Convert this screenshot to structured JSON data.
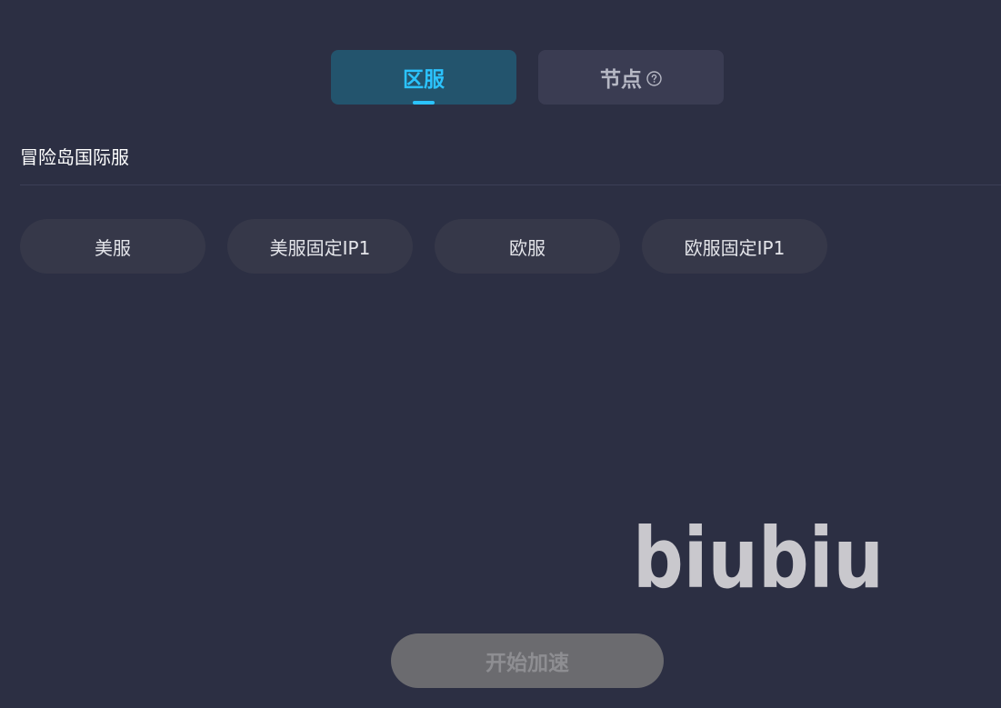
{
  "tabs": {
    "region_label": "区服",
    "node_label": "节点"
  },
  "game": {
    "title": "冒险岛国际服"
  },
  "servers": [
    {
      "label": "美服"
    },
    {
      "label": "美服固定IP1"
    },
    {
      "label": "欧服"
    },
    {
      "label": "欧服固定IP1"
    }
  ],
  "logo": {
    "text": "biubiu"
  },
  "start_button": {
    "label": "开始加速"
  },
  "colors": {
    "background": "#2c2f43",
    "accent": "#2bc3ff",
    "active_tab_bg": "#23546d",
    "inactive_tab_bg": "#3a3c52",
    "pill_bg": "#363849",
    "disabled_button_bg": "#6b6b6f"
  },
  "icons": {
    "help": "question-circle-icon"
  }
}
